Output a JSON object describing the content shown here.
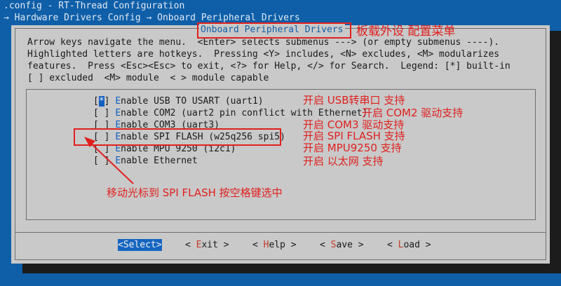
{
  "window": {
    "title": ".config - RT-Thread Configuration",
    "breadcrumb": "→ Hardware Drivers Config → Onboard Peripheral Drivers"
  },
  "dialog": {
    "title": "Onboard Peripheral Drivers",
    "help_lines": [
      "Arrow keys navigate the menu.  <Enter> selects submenus ---> (or empty submenus ----).",
      "Highlighted letters are hotkeys.  Pressing <Y> includes, <N> excludes, <M> modularizes",
      "features.  Press <Esc><Esc> to exit, <?> for Help, </> for Search.  Legend: [*] built-in",
      "[ ] excluded  <M> module  < > module capable"
    ],
    "menu_items": [
      {
        "prefix": "[",
        "state": "*",
        "suffix": "] ",
        "hotkey": "E",
        "rest": "nable USB TO USART (uart1)"
      },
      {
        "prefix": "[",
        "state": " ",
        "suffix": "] ",
        "hotkey": "E",
        "rest": "nable COM2 (uart2 pin conflict with Ethernet)"
      },
      {
        "prefix": "[",
        "state": " ",
        "suffix": "] ",
        "hotkey": "E",
        "rest": "nable COM3 (uart3)"
      },
      {
        "prefix": "[",
        "state": " ",
        "suffix": "] ",
        "hotkey": "E",
        "rest": "nable SPI FLASH (w25q256 spi5)"
      },
      {
        "prefix": "[",
        "state": " ",
        "suffix": "] ",
        "hotkey": "E",
        "rest": "nable MPU 9250 (i2c1)"
      },
      {
        "prefix": "[",
        "state": " ",
        "suffix": "] ",
        "hotkey": "E",
        "rest": "nable Ethernet"
      }
    ],
    "buttons": {
      "select": {
        "open": "<",
        "hotkey": "S",
        "rest": "elect",
        "close": ">"
      },
      "exit": {
        "open": "< ",
        "hotkey": "E",
        "rest": "xit",
        "close": " >"
      },
      "help": {
        "open": "< ",
        "hotkey": "H",
        "rest": "elp",
        "close": " >"
      },
      "save": {
        "open": "< ",
        "hotkey": "S",
        "rest": "ave",
        "close": " >"
      },
      "load": {
        "open": "< ",
        "hotkey": "L",
        "rest": "oad",
        "close": " >"
      }
    }
  },
  "annotations": {
    "title_note": "板载外设 配置菜单",
    "item_notes": [
      "开启 USB转串口 支持",
      "开启 COM2 驱动支持",
      "开启 COM3 驱动支持",
      "开启 SPI FLASH 支持",
      "开启 MPU9250 支持",
      "开启 以太网 支持"
    ],
    "arrow_note": "移动光标到 SPI FLASH 按空格键选中"
  },
  "colors": {
    "background": "#0f5fa8",
    "dialog": "#c9c9c9",
    "hotkey": "#1060c0",
    "annotation_red": "#e0201f"
  }
}
